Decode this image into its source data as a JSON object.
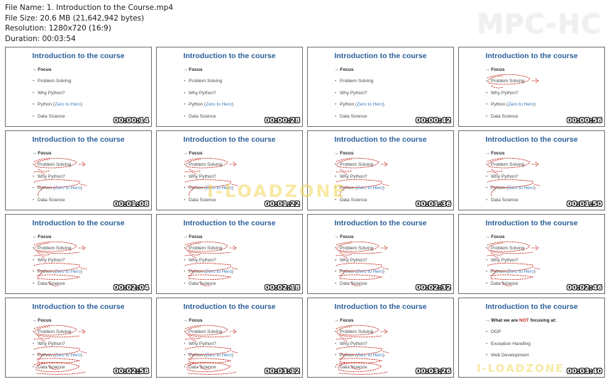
{
  "info": {
    "file_name": "File Name: 1. Introduction to the Course.mp4",
    "file_size": "File Size: 20.6 MB (21,642,942 bytes)",
    "resolution": "Resolution: 1280x720 (16:9)",
    "duration": "Duration: 00:03:54"
  },
  "brand": "MPC-HC",
  "watermark": "I-LOADZONE",
  "slide": {
    "title": "Introduction to the course",
    "focus_label": "→ Focus",
    "items": [
      "Problem Solving",
      "Why Python?",
      "Python (",
      "Zero to Hero",
      ")",
      "Data Science"
    ]
  },
  "last_slide": {
    "title": "Introduction to the course",
    "head_pre": "→ What we are ",
    "head_not": "NOT",
    "head_post": " focusing at:",
    "items": [
      "OOP",
      "Exception Handling",
      "Web Development"
    ]
  },
  "thumbnails": [
    {
      "time": "00:00:14",
      "annotation_level": 0
    },
    {
      "time": "00:00:28",
      "annotation_level": 0
    },
    {
      "time": "00:00:42",
      "annotation_level": 0
    },
    {
      "time": "00:00:56",
      "annotation_level": 1
    },
    {
      "time": "00:01:08",
      "annotation_level": 2
    },
    {
      "time": "00:01:22",
      "annotation_level": 2
    },
    {
      "time": "00:01:36",
      "annotation_level": 2
    },
    {
      "time": "00:01:50",
      "annotation_level": 2
    },
    {
      "time": "00:02:04",
      "annotation_level": 3
    },
    {
      "time": "00:02:18",
      "annotation_level": 3
    },
    {
      "time": "00:02:32",
      "annotation_level": 3
    },
    {
      "time": "00:02:46",
      "annotation_level": 3
    },
    {
      "time": "00:02:58",
      "annotation_level": 4
    },
    {
      "time": "00:03:12",
      "annotation_level": 4
    },
    {
      "time": "00:03:26",
      "annotation_level": 4
    },
    {
      "time": "00:03:40",
      "annotation_level": 0,
      "last": true
    }
  ],
  "colors": {
    "title_blue": "#2a5f9a",
    "annotation_red": "#c0281e",
    "thumb_border": "#6d6d6d"
  }
}
